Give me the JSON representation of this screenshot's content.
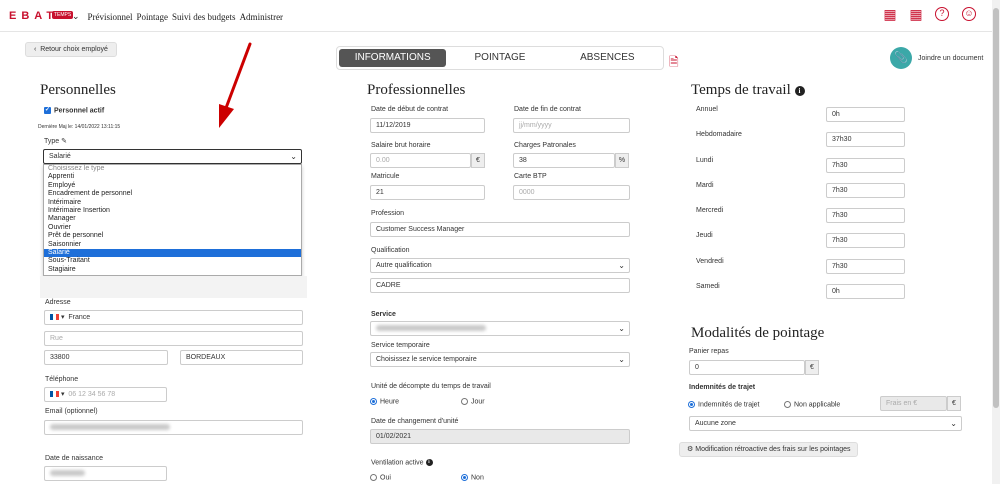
{
  "header": {
    "logo": "EBAT",
    "logo_badge": "TEMPS",
    "nav": [
      "Prévisionnel",
      "Pointage",
      "Suivi des budgets",
      "Administrer"
    ]
  },
  "back_button": "Retour choix employé",
  "tabs": [
    {
      "label": "INFORMATIONS",
      "active": true
    },
    {
      "label": "POINTAGE",
      "active": false
    },
    {
      "label": "ABSENCES",
      "active": false
    }
  ],
  "join_doc": "Joindre un document",
  "personnelles": {
    "title": "Personnelles",
    "actif": "Personnel actif",
    "maj": "Dernière Maj le: 14/01/2022 13:11:15",
    "type_label": "Type",
    "type_value": "Salarié",
    "options": [
      "Choisissez le type",
      "Apprenti",
      "Employé",
      "Encadrement de personnel",
      "Intérimaire",
      "Intérimaire Insertion",
      "Manager",
      "Ouvrier",
      "Prêt de personnel",
      "Saisonnier",
      "Salarié",
      "Sous-Traitant",
      "Stagiaire"
    ],
    "selected_option": "Salarié",
    "adresse_label": "Adresse",
    "pays": "France",
    "rue_ph": "Rue",
    "cp": "33800",
    "ville": "BORDEAUX",
    "tel_label": "Téléphone",
    "tel_ph": "06 12 34 56 78",
    "email_label": "Email (optionnel)",
    "naissance_label": "Date de naissance"
  },
  "pro": {
    "title": "Professionnelles",
    "debut_label": "Date de début de contrat",
    "debut": "11/12/2019",
    "fin_label": "Date de fin de contrat",
    "fin_ph": "jj/mm/yyyy",
    "salaire_label": "Salaire brut horaire",
    "salaire_ph": "0.00",
    "euro": "€",
    "charges_label": "Charges Patronales",
    "charges": "38",
    "pct": "%",
    "matricule_label": "Matricule",
    "matricule": "21",
    "btp_label": "Carte BTP",
    "btp_ph": "0000",
    "profession_label": "Profession",
    "profession": "Customer Success Manager",
    "qualif_label": "Qualification",
    "qualif": "Autre qualification",
    "qualif2": "CADRE",
    "service_label": "Service",
    "service_temp_label": "Service temporaire",
    "service_temp": "Choisissez le service temporaire",
    "unite_label": "Unité de décompte du temps de travail",
    "heure": "Heure",
    "jour": "Jour",
    "chg_unite_label": "Date de changement d'unité",
    "chg_unite": "01/02/2021",
    "ventil_label": "Ventilation active",
    "oui": "Oui",
    "non": "Non"
  },
  "temps": {
    "title": "Temps de travail",
    "rows": [
      {
        "label": "Annuel",
        "value": "0h"
      },
      {
        "label": "Hebdomadaire",
        "value": "37h30"
      },
      {
        "label": "Lundi",
        "value": "7h30"
      },
      {
        "label": "Mardi",
        "value": "7h30"
      },
      {
        "label": "Mercredi",
        "value": "7h30"
      },
      {
        "label": "Jeudi",
        "value": "7h30"
      },
      {
        "label": "Vendredi",
        "value": "7h30"
      },
      {
        "label": "Samedi",
        "value": "0h"
      }
    ]
  },
  "modalites": {
    "title": "Modalités de pointage",
    "panier_label": "Panier repas",
    "panier": "0",
    "euro": "€",
    "indem_label": "Indemnités de trajet",
    "indem_opt": "Indemnités de trajet",
    "non_app": "Non applicable",
    "frais_ph": "Frais en €",
    "zone": "Aucune zone",
    "modif_btn": "Modification rétroactive des frais sur les pointages"
  }
}
